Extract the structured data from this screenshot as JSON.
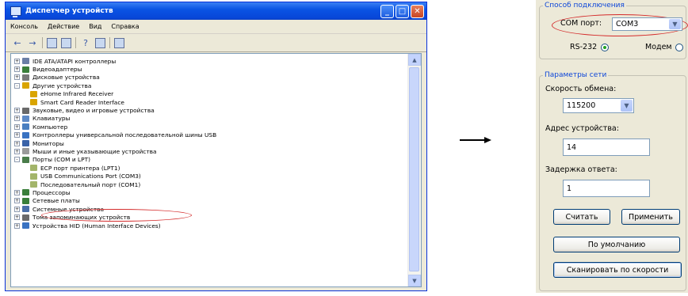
{
  "device_manager": {
    "title": "Диспетчер устройств",
    "menu": [
      "Консоль",
      "Действие",
      "Вид",
      "Справка"
    ],
    "tree": [
      {
        "label": "IDE ATA/ATAPI контроллеры",
        "level": 1,
        "state": "+"
      },
      {
        "label": "Видеоадаптеры",
        "level": 1,
        "state": "+"
      },
      {
        "label": "Дисковые устройства",
        "level": 1,
        "state": "+"
      },
      {
        "label": "Другие устройства",
        "level": 1,
        "state": "-"
      },
      {
        "label": "eHome Infrared Receiver",
        "level": 2,
        "state": ""
      },
      {
        "label": "Smart Card Reader Interface",
        "level": 2,
        "state": ""
      },
      {
        "label": "Звуковые, видео и игровые устройства",
        "level": 1,
        "state": "+"
      },
      {
        "label": "Клавиатуры",
        "level": 1,
        "state": "+"
      },
      {
        "label": "Компьютер",
        "level": 1,
        "state": "+"
      },
      {
        "label": "Контроллеры универсальной последовательной шины USB",
        "level": 1,
        "state": "+"
      },
      {
        "label": "Мониторы",
        "level": 1,
        "state": "+"
      },
      {
        "label": "Мыши и иные указывающие устройства",
        "level": 1,
        "state": "+"
      },
      {
        "label": "Порты (COM и LPT)",
        "level": 1,
        "state": "-"
      },
      {
        "label": "ECP порт принтера (LPT1)",
        "level": 2,
        "state": ""
      },
      {
        "label": "USB Communications Port (COM3)",
        "level": 2,
        "state": "",
        "highlighted": true
      },
      {
        "label": "Последовательный порт (COM1)",
        "level": 2,
        "state": ""
      },
      {
        "label": "Процессоры",
        "level": 1,
        "state": "+"
      },
      {
        "label": "Сетевые платы",
        "level": 1,
        "state": "+"
      },
      {
        "label": "Системные устройства",
        "level": 1,
        "state": "+"
      },
      {
        "label": "Тома запоминающих устройств",
        "level": 1,
        "state": "+"
      },
      {
        "label": "Устройства HID (Human Interface Devices)",
        "level": 1,
        "state": "+"
      }
    ]
  },
  "settings": {
    "connection_group": "Способ подключения",
    "com_port_label": "COM порт:",
    "com_port_value": "COM3",
    "rs232_label": "RS-232",
    "modem_label": "Модем",
    "network_group": "Параметры сети",
    "speed_label": "Скорость обмена:",
    "speed_value": "115200",
    "address_label": "Адрес устройства:",
    "address_value": "14",
    "delay_label": "Задержка ответа:",
    "delay_value": "1",
    "read_button": "Считать",
    "apply_button": "Применить",
    "default_button": "По умолчанию",
    "scan_button": "Сканировать по скорости"
  },
  "colors": {
    "highlight_oval": "#d42a2a",
    "group_legend": "#0d46d9",
    "titlebar": "#0a54e4"
  }
}
